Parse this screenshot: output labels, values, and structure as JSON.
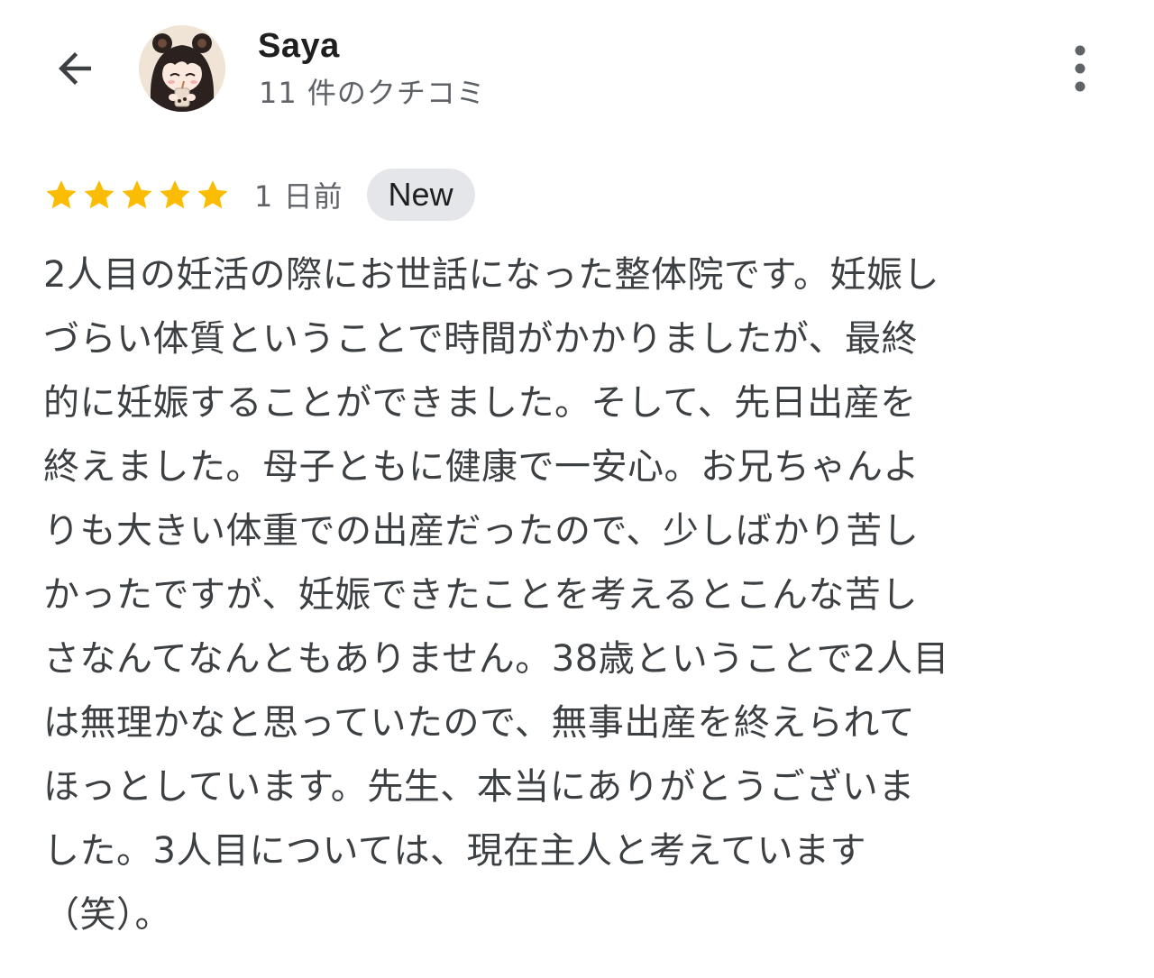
{
  "header": {
    "reviewer_name": "Saya",
    "reviewer_meta": "11 件のクチコミ"
  },
  "review": {
    "rating": 5,
    "rating_max": 5,
    "date": "1 日前",
    "badge": "New",
    "lines": [
      "2人目の妊活の際にお世話になった整体院です。妊娠し",
      "づらい体質ということで時間がかかりましたが、最終",
      "的に妊娠することができました。そして、先日出産を",
      "終えました。母子ともに健康で一安心。お兄ちゃんよ",
      "りも大きい体重での出産だったので、少しばかり苦し",
      "かったですが、妊娠できたことを考えるとこんな苦し",
      "さなんてなんともありません。38歳ということで2人目",
      "は無理かなと思っていたので、無事出産を終えられて",
      "ほっとしています。先生、本当にありがとうございま",
      "した。3人目については、現在主人と考えています",
      "（笑）。"
    ]
  },
  "icons": {
    "back": "arrow-back-icon",
    "more": "more-vert-icon",
    "star": "star-icon"
  },
  "colors": {
    "star": "#fbbc04",
    "badge_bg": "#e4e6e9",
    "secondary_text": "#5f6368",
    "body_text": "#3c4043"
  }
}
